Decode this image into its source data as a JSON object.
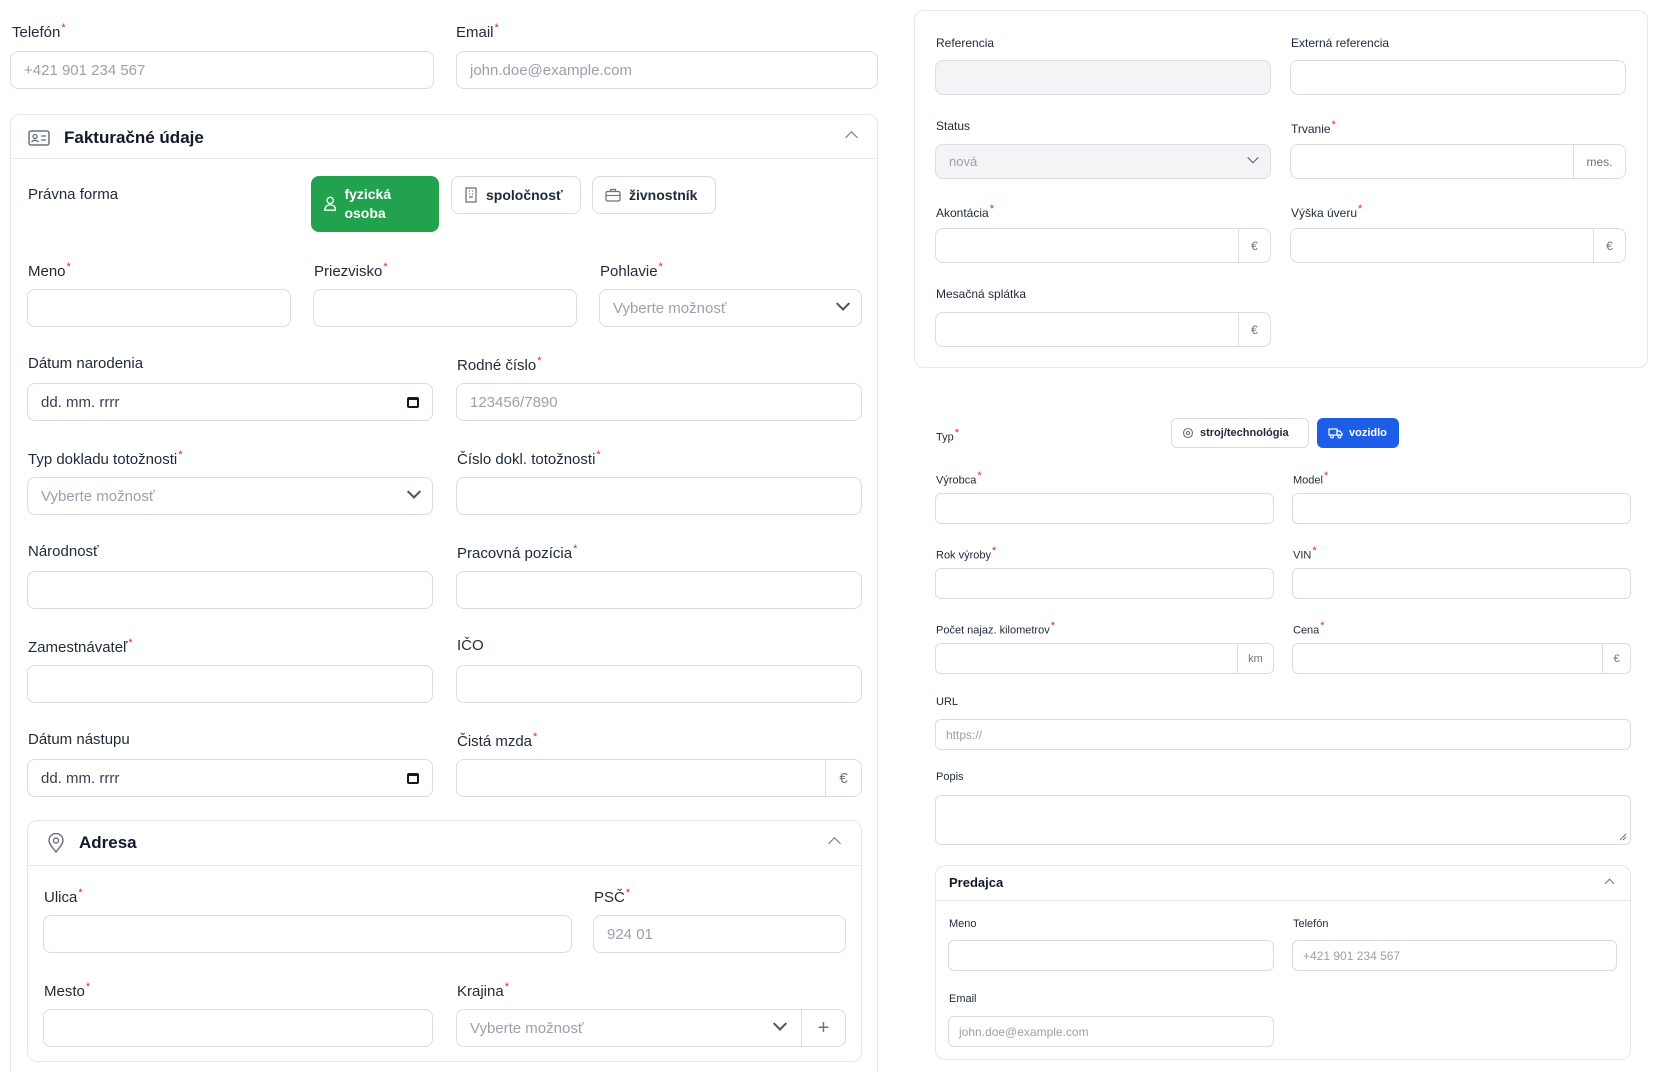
{
  "contact": {
    "phone_label": "Telefón",
    "phone_placeholder": "+421 901 234 567",
    "email_label": "Email",
    "email_placeholder": "john.doe@example.com"
  },
  "billing": {
    "title": "Fakturačné údaje",
    "legal_form_label": "Právna forma",
    "legal_forms": [
      "fyzická osoba",
      "spoločnosť",
      "živnostník"
    ],
    "first_name_label": "Meno",
    "last_name_label": "Priezvisko",
    "gender_label": "Pohlavie",
    "gender_placeholder": "Vyberte možnosť",
    "birth_date_label": "Dátum narodenia",
    "birth_date_placeholder": "dd. mm. rrrr",
    "birth_number_label": "Rodné číslo",
    "birth_number_placeholder": "123456/7890",
    "id_type_label": "Typ dokladu totožnosti",
    "id_type_placeholder": "Vyberte možnosť",
    "id_number_label": "Číslo dokl. totožnosti",
    "nationality_label": "Národnosť",
    "position_label": "Pracovná pozícia",
    "employer_label": "Zamestnávateľ",
    "ico_label": "IČO",
    "start_date_label": "Dátum nástupu",
    "start_date_placeholder": "dd. mm. rrrr",
    "net_salary_label": "Čistá mzda",
    "currency": "€"
  },
  "address": {
    "title": "Adresa",
    "street_label": "Ulica",
    "zip_label": "PSČ",
    "zip_placeholder": "924 01",
    "city_label": "Mesto",
    "country_label": "Krajina",
    "country_placeholder": "Vyberte možnosť",
    "add_symbol": "+"
  },
  "contract": {
    "reference_label": "Referencia",
    "external_reference_label": "Externá referencia",
    "status_label": "Status",
    "status_value": "nová",
    "duration_label": "Trvanie",
    "duration_unit": "mes.",
    "down_payment_label": "Akontácia",
    "loan_amount_label": "Výška úveru",
    "monthly_payment_label": "Mesačná splátka",
    "currency": "€"
  },
  "subject": {
    "type_label": "Typ",
    "types": [
      "stroj/technológia",
      "vozidlo"
    ],
    "manufacturer_label": "Výrobca",
    "model_label": "Model",
    "year_label": "Rok výroby",
    "vin_label": "VIN",
    "mileage_label": "Počet najaz. kilometrov",
    "mileage_unit": "km",
    "price_label": "Cena",
    "currency": "€",
    "url_label": "URL",
    "url_placeholder": "https://",
    "description_label": "Popis"
  },
  "seller": {
    "title": "Predajca",
    "name_label": "Meno",
    "phone_label": "Telefón",
    "phone_placeholder": "+421 901 234 567",
    "email_label": "Email",
    "email_placeholder": "john.doe@example.com"
  },
  "colors": {
    "accent_green": "#22a14f",
    "accent_blue": "#1d5ee8",
    "required": "#e11d48"
  }
}
